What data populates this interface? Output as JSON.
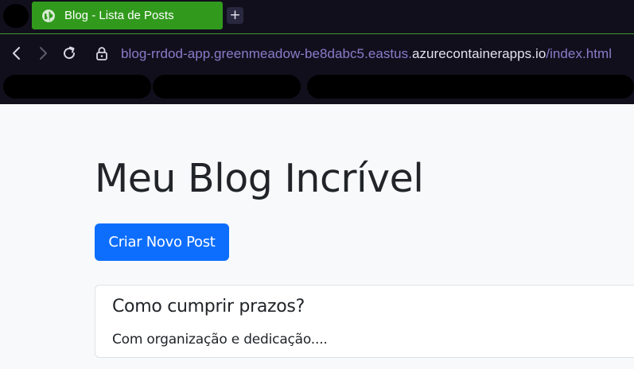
{
  "browser": {
    "tab": {
      "title": "Blog - Lista de Posts",
      "icon": "globe-icon"
    },
    "new_tab_symbol": "+",
    "address": {
      "prefix": "blog-rrdod-app.greenmeadow-be8dabc5.eastus.",
      "host": "azurecontainerapps.io",
      "path": "/index.html"
    },
    "accent_color": "#319a1d"
  },
  "page": {
    "title": "Meu Blog Incrível",
    "new_post_button": "Criar Novo Post",
    "posts": [
      {
        "title": "Como cumprir prazos?",
        "excerpt": "Com organização e dedicação...."
      }
    ],
    "button_color": "#0d6efd"
  }
}
